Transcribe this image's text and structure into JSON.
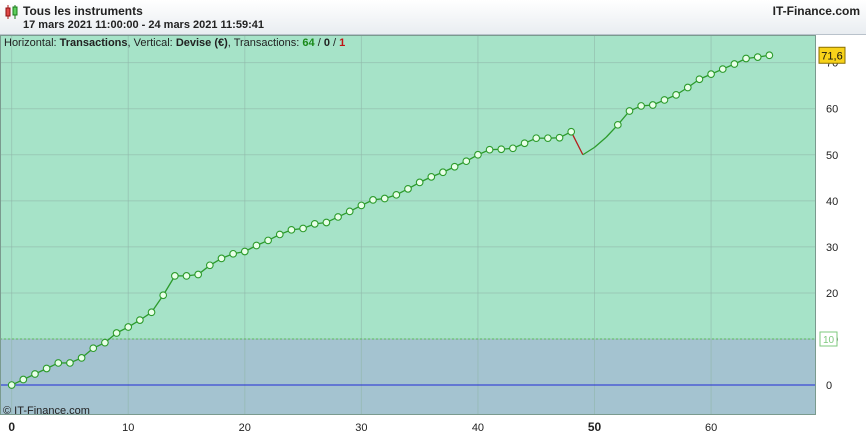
{
  "header": {
    "title": "Tous les instruments",
    "dates": "17 mars 2021 11:00:00 - 24 mars 2021 11:59:41",
    "brand": "IT-Finance.com"
  },
  "info": {
    "horizontal_label": "Horizontal:",
    "horizontal_value": "Transactions",
    "vertical_label": ", Vertical:",
    "vertical_value": "Devise (€)",
    "transactions_label": ", Transactions:",
    "wins": "64",
    "sep1": " / ",
    "flat": "0",
    "sep2": " / ",
    "losses": "1"
  },
  "copyright": "© IT-Finance.com",
  "colors": {
    "profit_zone": "#a6e3c8",
    "loss_zone": "#a4c3d0",
    "line": "#2c9b2c",
    "loss_segment": "#b51c1c",
    "zero_line": "#1f2bd6",
    "last_value_badge": "#f7d21a",
    "threshold_label": "#7ec97e"
  },
  "chart_data": {
    "type": "line",
    "xlabel": "",
    "ylabel": "",
    "xlim": [
      -1,
      69
    ],
    "ylim": [
      -6.5,
      76
    ],
    "x_ticks": [
      "0",
      "10",
      "20",
      "30",
      "40",
      "50",
      "60"
    ],
    "x_tick_values": [
      0,
      10,
      20,
      30,
      40,
      50,
      60
    ],
    "x_ticks_bold": [
      0,
      50
    ],
    "y_ticks": [
      "0",
      "10",
      "20",
      "30",
      "40",
      "50",
      "60",
      "70"
    ],
    "y_tick_values": [
      0,
      10,
      20,
      30,
      40,
      50,
      60,
      70
    ],
    "threshold": 10,
    "threshold_label": "10",
    "last_value_label": "71,6",
    "last_value": 71.6,
    "loss_index": 49,
    "values": [
      0,
      1.2,
      2.4,
      3.6,
      4.8,
      4.8,
      5.9,
      8,
      9.2,
      11.3,
      12.6,
      14.1,
      15.8,
      19.5,
      23.7,
      23.7,
      24,
      26,
      27.5,
      28.5,
      29,
      30.3,
      31.4,
      32.7,
      33.7,
      34,
      35,
      35.3,
      36.5,
      37.7,
      39,
      40.2,
      40.5,
      41.3,
      42.6,
      44,
      45.2,
      46.2,
      47.4,
      48.6,
      50,
      51.1,
      51.2,
      51.4,
      52.5,
      53.6,
      53.6,
      53.7,
      55,
      50,
      51.6,
      53.8,
      56.5,
      59.5,
      60.6,
      60.8,
      61.9,
      63,
      64.6,
      66.4,
      67.5,
      68.6,
      69.7,
      70.9,
      71.2,
      71.6
    ],
    "markers_hidden": [
      49,
      50,
      51
    ]
  }
}
